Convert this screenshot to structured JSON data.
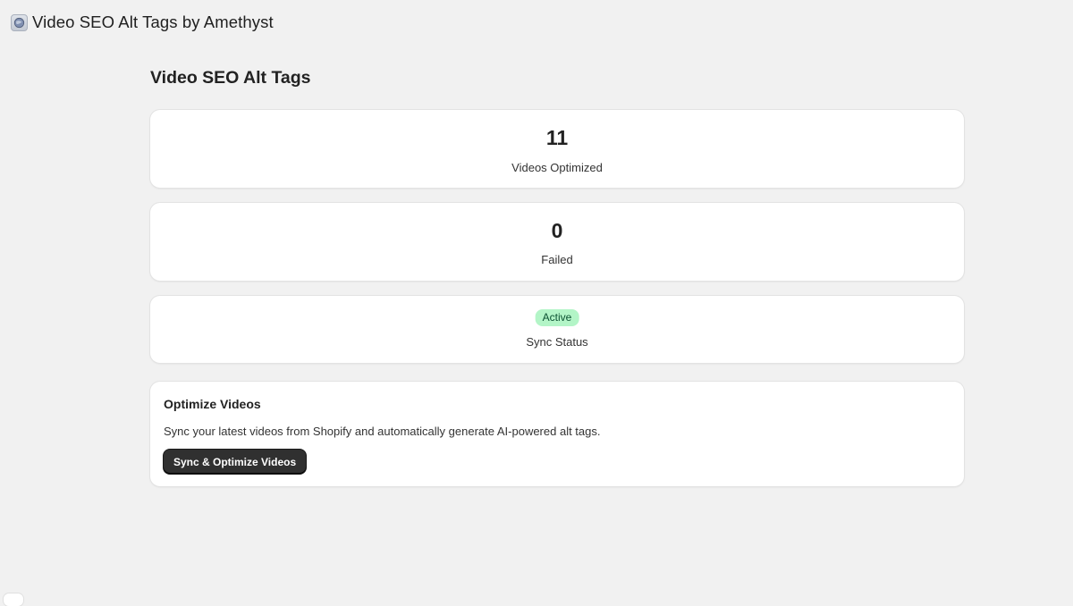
{
  "app": {
    "title": "Video SEO Alt Tags by Amethyst",
    "icon": "amethyst-app-icon"
  },
  "page": {
    "title": "Video SEO Alt Tags"
  },
  "stats": {
    "optimized": {
      "value": "11",
      "label": "Videos Optimized"
    },
    "failed": {
      "value": "0",
      "label": "Failed"
    },
    "sync": {
      "badge": "Active",
      "label": "Sync Status"
    }
  },
  "optimize_section": {
    "title": "Optimize Videos",
    "description": "Sync your latest videos from Shopify and automatically generate AI-powered alt tags.",
    "button_label": "Sync & Optimize Videos"
  },
  "colors": {
    "background": "#f1f1f1",
    "card": "#ffffff",
    "badge_success_bg": "#b3f5c7",
    "badge_success_text": "#0c5132",
    "primary_button": "#303030"
  }
}
